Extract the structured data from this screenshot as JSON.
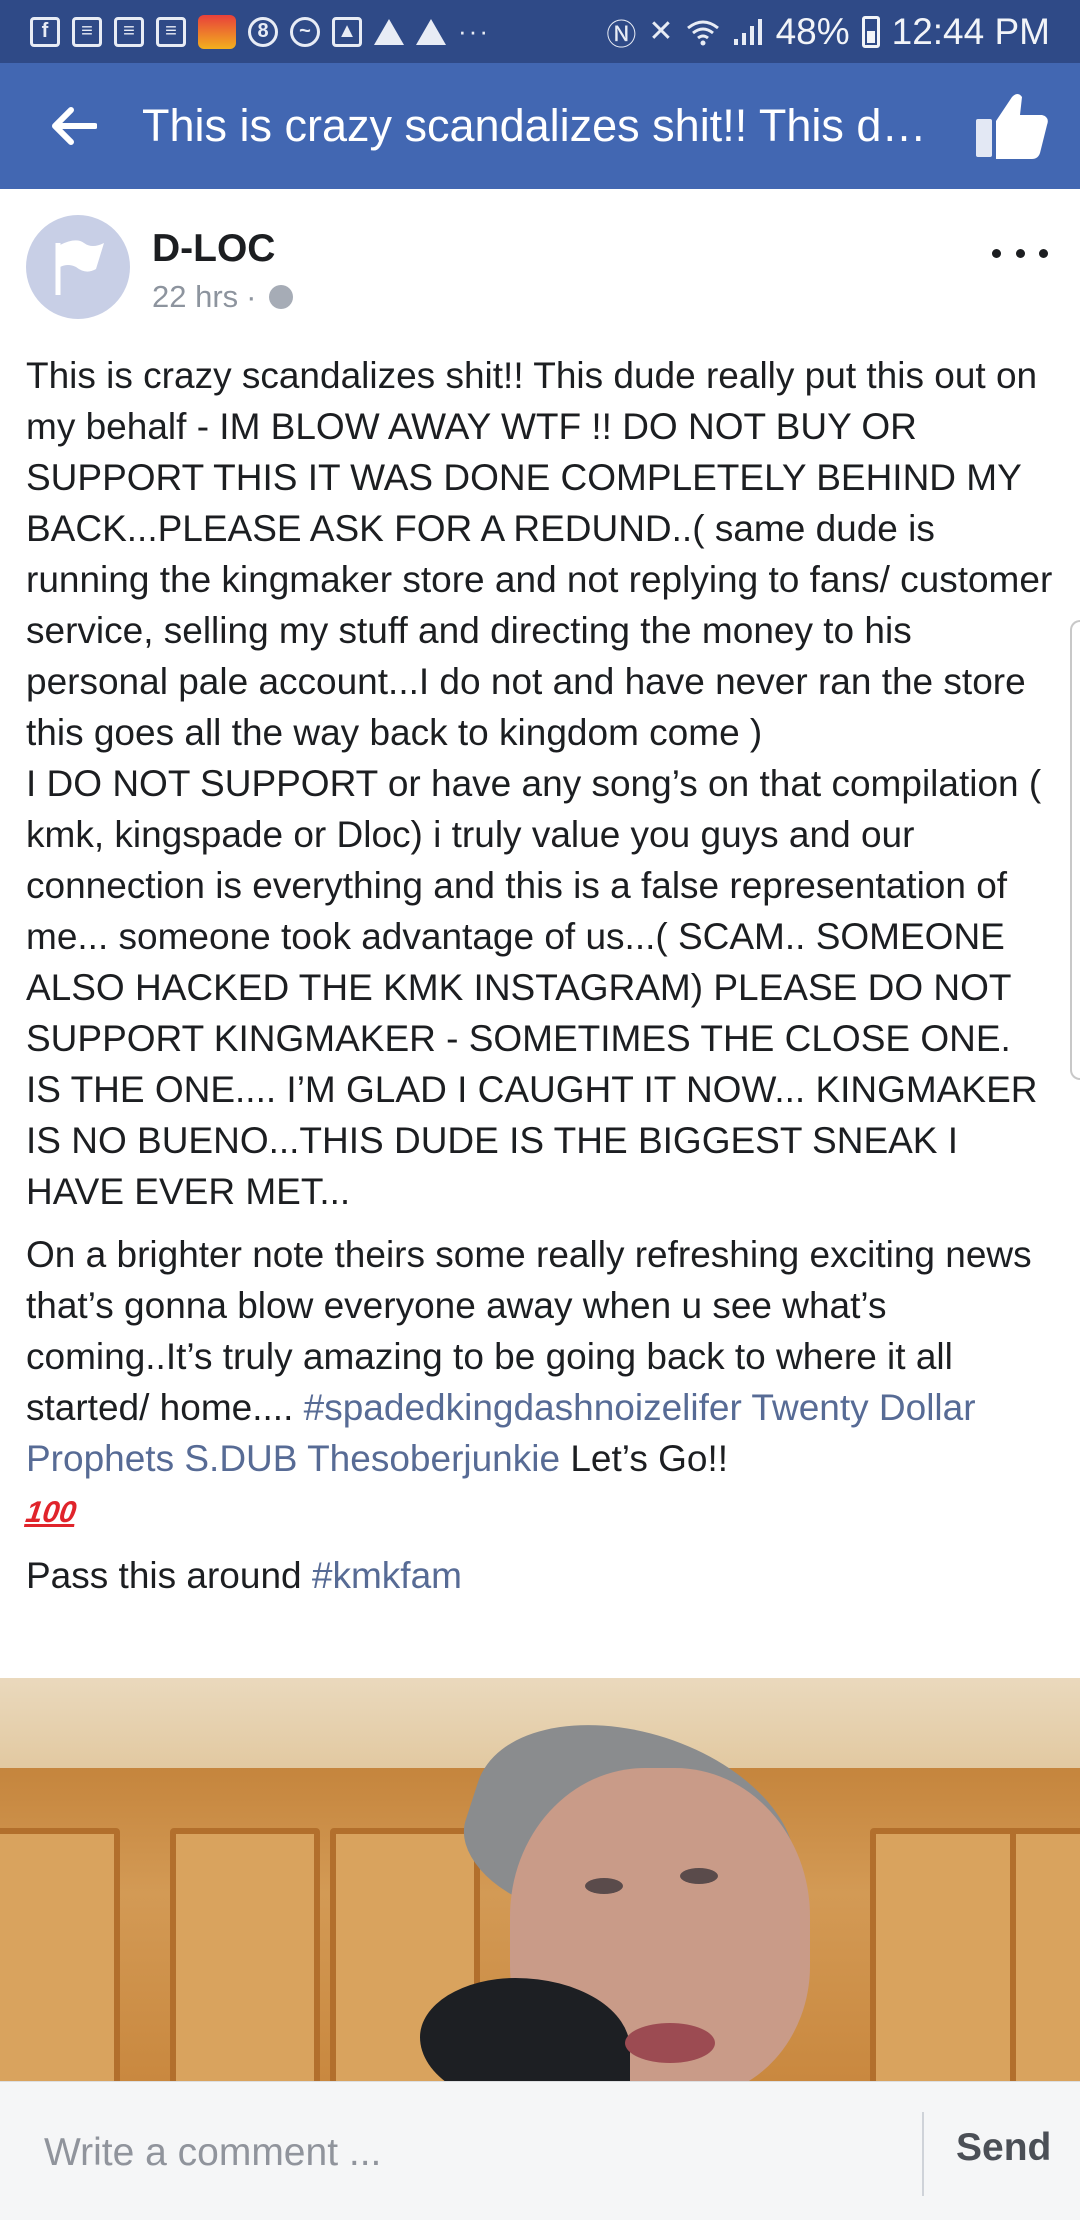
{
  "status_bar": {
    "battery": "48%",
    "time": "12:44 PM",
    "overflow_dots": "···"
  },
  "app_bar": {
    "title": "This is crazy scandalizes shit!! This dude really put this out on my behalf - IM BLOW AWAY WTF !!"
  },
  "post": {
    "author": "D-LOC",
    "time_ago": "22 hrs",
    "meta_separator": "·",
    "paragraph1": "This is crazy scandalizes shit!! This dude really put this out on my behalf - IM BLOW AWAY WTF !! DO NOT BUY OR SUPPORT THIS IT WAS DONE COMPLETELY BEHIND MY BACK...PLEASE ASK FOR A REDUND..( same dude is running the kingmaker store and not replying to fans/ customer service, selling my stuff and directing the money to his personal pale account...I do not and have never ran the store this goes all the way back to kingdom come )",
    "paragraph2": "I DO NOT SUPPORT or have any song’s on that compilation ( kmk, kingspade or Dloc) i truly value you guys and our connection is everything and this is a false representation of me... someone took advantage of us...( SCAM.. SOMEONE ALSO HACKED THE KMK INSTAGRAM) PLEASE DO NOT SUPPORT KINGMAKER - SOMETIMES THE CLOSE ONE. IS THE ONE.... I’M GLAD I CAUGHT IT NOW... KINGMAKER IS NO BUENO...THIS DUDE IS THE BIGGEST SNEAK I HAVE EVER MET...",
    "paragraph3_text": "On a brighter note theirs some really refreshing exciting news that’s gonna blow everyone away when u see what’s coming..It’s truly amazing to be going back to where it all started/ home.... ",
    "hashtag_spade": "#spadedkingdashnoizelifer",
    "mention_1": "Twenty Dollar Prophets",
    "mention_2": "S.DUB",
    "mention_3": "Thesoberjunkie",
    "paragraph3_end": " Let’s Go!!",
    "emoji_100": "100",
    "paragraph4_text": "Pass this around ",
    "hashtag_kmkfam": "#kmkfam"
  },
  "comment_bar": {
    "placeholder": "Write a comment ...",
    "send_label": "Send"
  }
}
